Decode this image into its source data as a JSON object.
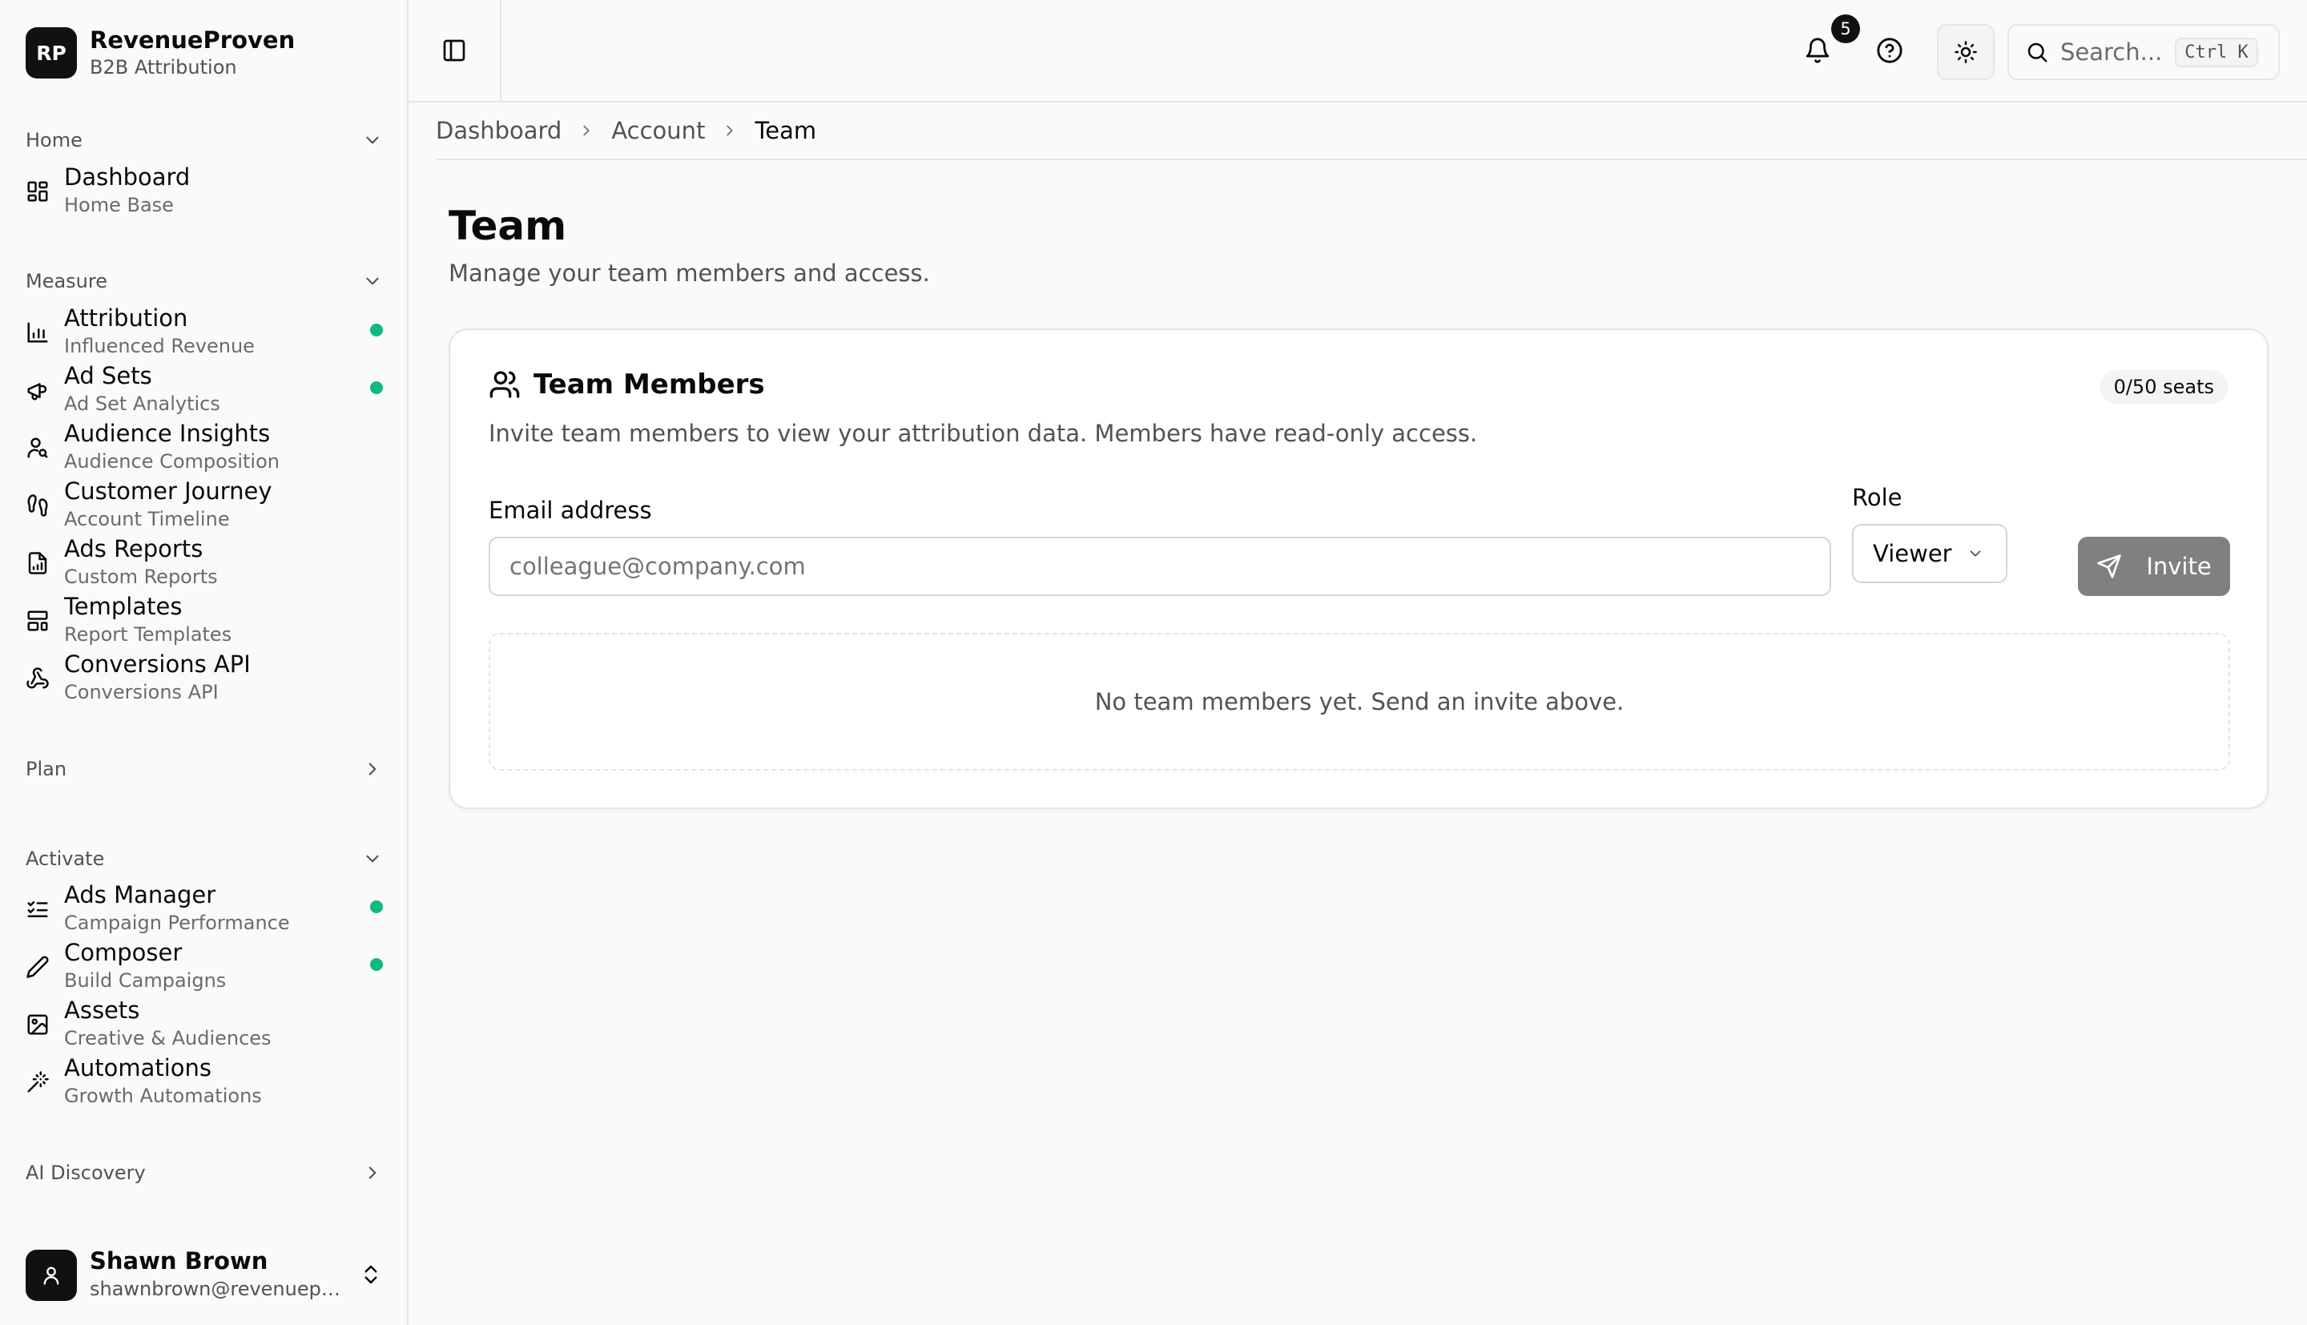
{
  "brand": {
    "logo": "RP",
    "name": "RevenueProven",
    "subtitle": "B2B Attribution"
  },
  "colors": {
    "status_dot": "#10b981",
    "accent": "#111111",
    "invite_button": "#808080"
  },
  "sidebar": {
    "groups": [
      {
        "label": "Home",
        "expanded": true,
        "items": [
          {
            "title": "Dashboard",
            "subtitle": "Home Base",
            "icon": "grid-icon",
            "status": false
          }
        ]
      },
      {
        "label": "Measure",
        "expanded": true,
        "items": [
          {
            "title": "Attribution",
            "subtitle": "Influenced Revenue",
            "icon": "bar-chart-icon",
            "status": true
          },
          {
            "title": "Ad Sets",
            "subtitle": "Ad Set Analytics",
            "icon": "megaphone-icon",
            "status": true
          },
          {
            "title": "Audience Insights",
            "subtitle": "Audience Composition",
            "icon": "user-search-icon",
            "status": false
          },
          {
            "title": "Customer Journey",
            "subtitle": "Account Timeline",
            "icon": "footprints-icon",
            "status": false
          },
          {
            "title": "Ads Reports",
            "subtitle": "Custom Reports",
            "icon": "report-icon",
            "status": false
          },
          {
            "title": "Templates",
            "subtitle": "Report Templates",
            "icon": "template-icon",
            "status": false
          },
          {
            "title": "Conversions API",
            "subtitle": "Conversions API",
            "icon": "webhook-icon",
            "status": false
          }
        ]
      },
      {
        "label": "Plan",
        "expanded": false,
        "items": []
      },
      {
        "label": "Activate",
        "expanded": true,
        "items": [
          {
            "title": "Ads Manager",
            "subtitle": "Campaign Performance",
            "icon": "list-checks-icon",
            "status": true
          },
          {
            "title": "Composer",
            "subtitle": "Build Campaigns",
            "icon": "pen-icon",
            "status": true
          },
          {
            "title": "Assets",
            "subtitle": "Creative & Audiences",
            "icon": "image-icon",
            "status": false
          },
          {
            "title": "Automations",
            "subtitle": "Growth Automations",
            "icon": "wand-icon",
            "status": false
          }
        ]
      },
      {
        "label": "AI Discovery",
        "expanded": false,
        "items": []
      }
    ]
  },
  "user": {
    "name": "Shawn Brown",
    "email": "shawnbrown@revenueproven.com"
  },
  "topbar": {
    "notifications_count": "5",
    "search_placeholder": "Search...",
    "search_shortcut": "Ctrl K"
  },
  "breadcrumb": [
    "Dashboard",
    "Account",
    "Team"
  ],
  "page": {
    "title": "Team",
    "subtitle": "Manage your team members and access."
  },
  "team_card": {
    "title": "Team Members",
    "seats": "0/50 seats",
    "description": "Invite team members to view your attribution data. Members have read-only access.",
    "email_label": "Email address",
    "email_placeholder": "colleague@company.com",
    "email_value": "",
    "role_label": "Role",
    "role_value": "Viewer",
    "invite_label": "Invite",
    "empty_message": "No team members yet. Send an invite above."
  }
}
